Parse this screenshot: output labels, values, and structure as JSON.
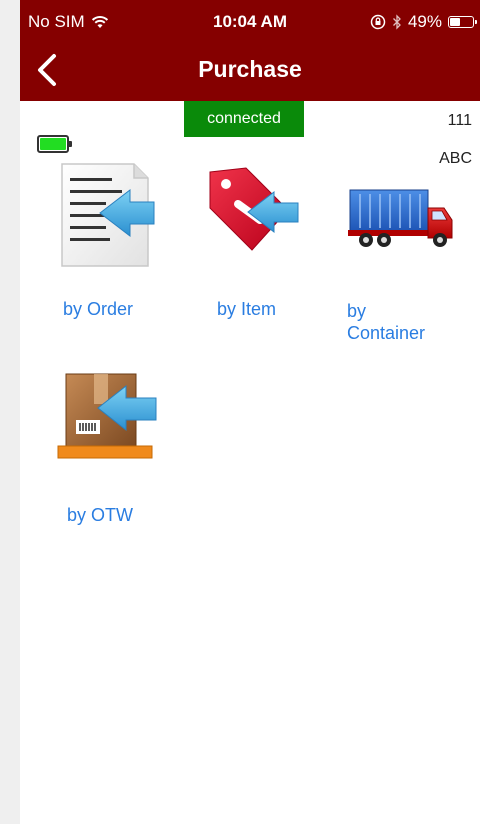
{
  "status_bar": {
    "carrier": "No SIM",
    "time": "10:04 AM",
    "battery_percent": "49%",
    "battery_level": 0.49
  },
  "nav": {
    "title": "Purchase"
  },
  "connection": {
    "status": "connected",
    "color": "#0a8a0a"
  },
  "device": {
    "code_top": "111",
    "code_bottom": "ABC",
    "battery_color": "#22dd22"
  },
  "theme": {
    "header_color": "#850000",
    "link_color": "#2a7de1"
  },
  "menu": [
    {
      "label": "by Order",
      "icon": "document-arrow-icon"
    },
    {
      "label": "by Item",
      "icon": "tag-arrow-icon"
    },
    {
      "label": "by\nContainer",
      "icon": "truck-icon"
    },
    {
      "label": "by OTW",
      "icon": "box-arrow-icon"
    }
  ]
}
